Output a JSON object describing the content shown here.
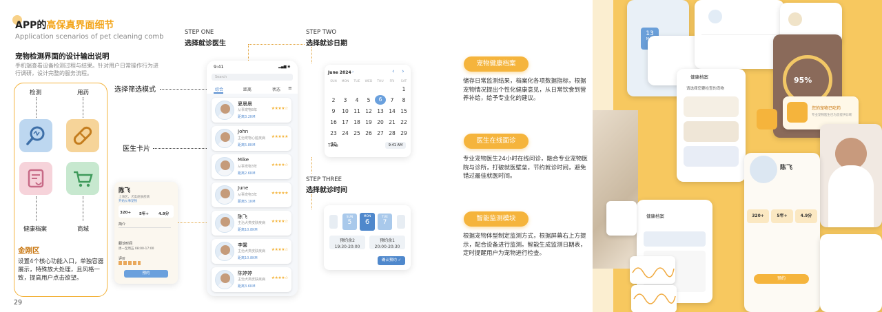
{
  "header": {
    "title_prefix": "APP的",
    "title_highlight": "高保真界面细节",
    "subtitle": "Application scenarios of pet cleaning comb"
  },
  "section": {
    "title": "宠物检测界面的设计输出说明",
    "description": "手机端查看设备检测过程与结果。针对用户日常操作行为进行调研，设计完整的服务流程。"
  },
  "kingkong": {
    "items": [
      {
        "label": "检测",
        "icon": "magnifier-icon"
      },
      {
        "label": "用药",
        "icon": "pill-icon"
      },
      {
        "label": "健康档案",
        "icon": "health-record-icon"
      },
      {
        "label": "商城",
        "icon": "cart-icon"
      }
    ],
    "title": "金刚区",
    "description": "设置4个核心功能入口，单独容器展示，特殊放大处理，且风格一致，提高用户点击欲望。"
  },
  "pages": {
    "left": "29",
    "right": "30"
  },
  "annotations": {
    "filter_mode": "选择筛选模式",
    "doctor_card": "医生卡片"
  },
  "steps": [
    {
      "label": "STEP ONE",
      "title": "选择就诊医生"
    },
    {
      "label": "STEP TWO",
      "title": "选择就诊日期"
    },
    {
      "label": "STEP THREE",
      "title": "选择就诊时间"
    }
  ],
  "doctor_app": {
    "time": "9:41",
    "search_placeholder": "Search",
    "tabs": [
      "综合",
      "距离",
      "状态"
    ],
    "doctors": [
      {
        "name": "夏晨晨",
        "sub": "从事宠物8年",
        "dist": "距离3.2KM",
        "stars": "★★★★☆"
      },
      {
        "name": "John",
        "sub": "主治宠物心脏疾病",
        "dist": "距离5.8KM",
        "stars": "★★★★★"
      },
      {
        "name": "Mike",
        "sub": "从事宠物3年",
        "dist": "距离2.6KM",
        "stars": "★★★★☆"
      },
      {
        "name": "June",
        "sub": "从事宠物3年",
        "dist": "距离5.1KM",
        "stars": "★★★★★"
      },
      {
        "name": "陈飞",
        "sub": "主治犬类皮肤疾病",
        "dist": "距离10.8KM",
        "stars": "★★★★☆"
      },
      {
        "name": "李馨",
        "sub": "主治犬类皮肤疾病",
        "dist": "距离10.8KM",
        "stars": "★★★★☆"
      },
      {
        "name": "陈婷婷",
        "sub": "主治犬类皮肤疾病",
        "dist": "距离3.6KM",
        "stars": "★★★★☆"
      }
    ]
  },
  "doctor_detail": {
    "name": "陈飞",
    "line1": "上海区，犬类皮肤疾病",
    "line2": "开始从事宠物",
    "stat1": "320+",
    "stat2": "5年+",
    "stat3": "4.9分",
    "intro_label": "简介",
    "hours_label": "服诊时间",
    "hours": "周一至周五 08:00-17:00",
    "reviews_label": "评价",
    "button": "预约"
  },
  "calendar": {
    "month": "June 2024",
    "weekdays": [
      "SUN",
      "MON",
      "TUE",
      "WED",
      "THU",
      "FRI",
      "SAT"
    ],
    "rows": [
      [
        "",
        "",
        "",
        "",
        "",
        "",
        "1"
      ],
      [
        "2",
        "3",
        "4",
        "5",
        "6",
        "7",
        "8"
      ],
      [
        "9",
        "10",
        "11",
        "12",
        "13",
        "14",
        "15"
      ],
      [
        "16",
        "17",
        "18",
        "19",
        "20",
        "21",
        "22"
      ],
      [
        "23",
        "24",
        "25",
        "26",
        "27",
        "28",
        "29"
      ],
      [
        "30",
        "",
        "",
        "",
        "",
        "",
        ""
      ]
    ],
    "r0": [
      "1",
      "2",
      "3",
      "4"
    ],
    "selected": "6",
    "time_label": "Time",
    "time_value": "9:41 AM"
  },
  "timepicker": {
    "days": [
      {
        "wk": "SUN",
        "d": "5"
      },
      {
        "wk": "MON",
        "d": "6"
      },
      {
        "wk": "TUE",
        "d": "7"
      }
    ],
    "slots": [
      {
        "label": "预约余2",
        "time": "19:30-20:00"
      },
      {
        "label": "预约余1",
        "time": "20:00-20:30"
      }
    ],
    "confirm": "确认预约"
  },
  "features": [
    {
      "badge": "宠物健康档案",
      "desc": "储存日常监测结果，档案化各项数据指标，根据宠物情况提出个性化健康意见，从日常饮食到营养补给，给予专业化的建议。"
    },
    {
      "badge": "医生在线面诊",
      "desc": "专业宠物医生24小时在线问诊，融合专业宠物医院与诊所，打破就医壁垒，节约就诊时间，避免错过最佳就医时间。"
    },
    {
      "badge": "智能监测模块",
      "desc": "根据宠物体型制定监测方式，根据屏幕右上方提示，配合设备进行监测。智能生成监测日期表，定时提醒用户为宠物进行检查。"
    }
  ],
  "showcase": {
    "health_title": "健康档案",
    "pet_select": "请选择您要检查的宠物",
    "app_time": "9:41",
    "doctor_name": "陈飞",
    "stat1": "320+",
    "stat2": "5年+",
    "stat3": "4.9分",
    "percent": "95%",
    "reminder": "您的宠物已吃药",
    "reminder_sub": "专业宠物医生已为您提供诊断",
    "date_num": "13",
    "date_wk": "Mon",
    "button": "预约"
  },
  "colors": {
    "accent": "#f5b43c",
    "blue": "#5a8fd1",
    "right_bg": "#f7c85f"
  }
}
